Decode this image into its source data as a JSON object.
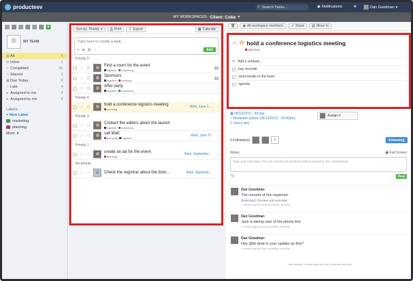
{
  "app": {
    "name": "producteev"
  },
  "topbar": {
    "search_placeholder": "Search Tasks...",
    "notifications": "Notifications",
    "user": "Dan Goodman"
  },
  "workspace": {
    "prefix": "MY WORKSPACES:",
    "name": "Client: Coke"
  },
  "sidebar": {
    "team_label": "MY TEAM",
    "filters": [
      {
        "label": "All",
        "count": "6",
        "icon": "all-icon",
        "active": true
      },
      {
        "label": "Inbox",
        "count": "1",
        "icon": "inbox-icon"
      },
      {
        "label": "Completed",
        "count": "51",
        "icon": "check-icon"
      },
      {
        "label": "Starred",
        "count": "2",
        "icon": "star-icon"
      },
      {
        "label": "Due Today",
        "count": "0",
        "icon": "calendar-icon"
      },
      {
        "label": "Late",
        "count": "4",
        "icon": "clock-icon"
      },
      {
        "label": "Assigned to me",
        "count": "2",
        "icon": "person-icon"
      },
      {
        "label": "Assigned by me",
        "count": "6",
        "icon": "person-icon"
      }
    ],
    "labels_head": "Labels:",
    "new_label": "+ New Label",
    "labels": [
      {
        "name": "marketing",
        "color": "#3f8f3f"
      },
      {
        "name": "planning",
        "color": "#b0307a"
      }
    ],
    "more": "More"
  },
  "tasklist": {
    "sort_label": "Sort by: Priority",
    "print_label": "Print",
    "export_label": "Export",
    "calendar_label": "Calendar",
    "new_task_placeholder": "Type here to create a task...",
    "add_label": "Add",
    "groups": [
      {
        "name": "Priority 5",
        "tasks": [
          {
            "title": "Find a room for the event",
            "tags": [
              {
                "name": "logistics",
                "color": "#333333"
              },
              {
                "name": "marketing",
                "color": "#3f8f3f"
              }
            ],
            "star": "#c62828",
            "count": "1"
          },
          {
            "title": "Sponsors",
            "tags": [
              {
                "name": "logistics",
                "color": "#333333"
              },
              {
                "name": "planning",
                "color": "#b0307a"
              }
            ],
            "star": "#c62828",
            "count": "3"
          },
          {
            "title": "After party",
            "tags": [
              {
                "name": "logistics",
                "color": "#333333"
              },
              {
                "name": "marketing",
                "color": "#3f8f3f"
              }
            ],
            "star": "#c62828",
            "count": ""
          }
        ]
      },
      {
        "name": "Priority 4",
        "tasks": [
          {
            "title": "hold a conference logistics meeting",
            "tags": [
              {
                "name": "planning",
                "color": "#b0307a"
              }
            ],
            "star": "#e67e22",
            "date": "Wed, June 1...",
            "count": "",
            "selected": true
          }
        ]
      },
      {
        "name": "Priority 3",
        "tasks": [
          {
            "title": "Contact the editors about the launch",
            "tags": [
              {
                "name": "logistics",
                "color": "#333333"
              },
              {
                "name": "marketing",
                "color": "#3f8f3f"
              }
            ],
            "star": "#e67e22",
            "count": ""
          },
          {
            "title": "call Matt",
            "tags": [
              {
                "name": "planning",
                "color": "#b0307a"
              },
              {
                "name": "logistics",
                "color": "#333333"
              }
            ],
            "star": "#e67e22",
            "date": "Wed, June 27",
            "count": ""
          }
        ]
      },
      {
        "name": "Priority 1",
        "tasks": [
          {
            "title": "create an ad for the event",
            "tags": [
              {
                "name": "planning",
                "color": "#b0307a"
              }
            ],
            "star": "#e8d33a",
            "date": "Wed, Septembe...",
            "count": ""
          }
        ]
      },
      {
        "name": "No priority",
        "tasks": [
          {
            "title": "Check the registrar about the dom...",
            "tags": [],
            "star": "#c9c9c9",
            "date": "Wed, Septemb...",
            "count": "",
            "generic_avatar": true
          }
        ]
      }
    ]
  },
  "detail": {
    "toolbar": {
      "members": "All workspace members",
      "share": "Share",
      "move": "Move to"
    },
    "title": "hold a conference logistics meeting",
    "tag": "planning",
    "add_subtask": "Add a subtask...",
    "subtasks": [
      "buy recorder",
      "send emails to the team",
      "agenda"
    ],
    "meta": [
      "06/13/2012 - All day",
      "Reminder before (06/12/2012 - 05:00pm)",
      "Every day"
    ],
    "assign_label": "Assign it",
    "followers_label": "2 Follower(s)",
    "following_label": "Following",
    "notes_label": "Notes:",
    "fullscreen_label": "Full Screen",
    "notes_placeholder": "Type your note here. You can use the @ symbol to add someone to the conversation.",
    "post_label": "Post",
    "activity": [
      {
        "name": "Dan Goodman",
        "text": "The resume of the organizer",
        "link": "Download | Preview and annotate",
        "time": "1 minute ago by Dan Goodman via Web"
      },
      {
        "name": "Dan Goodman",
        "text": "Jack is taking care of the phone line",
        "link": "",
        "time": "1 minute ago by Dan Goodman via Web"
      },
      {
        "name": "Dan Goodman",
        "text": "Hey @bt what is your update on this?",
        "link": "",
        "time": "1 minute ago by Dan Goodman via Web"
      }
    ],
    "created": "Task created 1 month ago by Dan Goodman via Web"
  }
}
